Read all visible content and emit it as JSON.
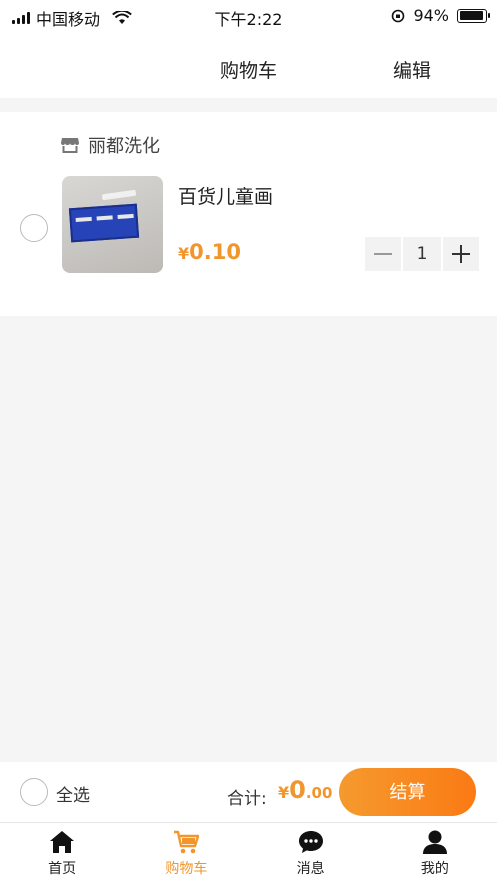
{
  "status_bar": {
    "carrier": "中国移动",
    "time": "下午2:22",
    "battery_percent": "94%",
    "battery_level": 0.94
  },
  "nav": {
    "title": "购物车",
    "edit_label": "编辑"
  },
  "shop": {
    "name": "丽都洗化",
    "icon": "store-icon"
  },
  "item": {
    "title": "百货儿童画",
    "price_symbol": "¥",
    "price": "0.10",
    "quantity": "1"
  },
  "checkout": {
    "select_all_label": "全选",
    "total_label": "合计:",
    "total_symbol": "¥",
    "total_int": "0",
    "total_dec": ".00",
    "button_label": "结算"
  },
  "tabs": [
    {
      "label": "首页",
      "icon": "home-icon"
    },
    {
      "label": "购物车",
      "icon": "cart-icon",
      "active": true
    },
    {
      "label": "消息",
      "icon": "message-icon"
    },
    {
      "label": "我的",
      "icon": "user-icon"
    }
  ],
  "colors": {
    "accent": "#f0962d",
    "button_gradient_start": "#f59a2e",
    "button_gradient_end": "#fb7a14",
    "background": "#f5f5f5"
  }
}
